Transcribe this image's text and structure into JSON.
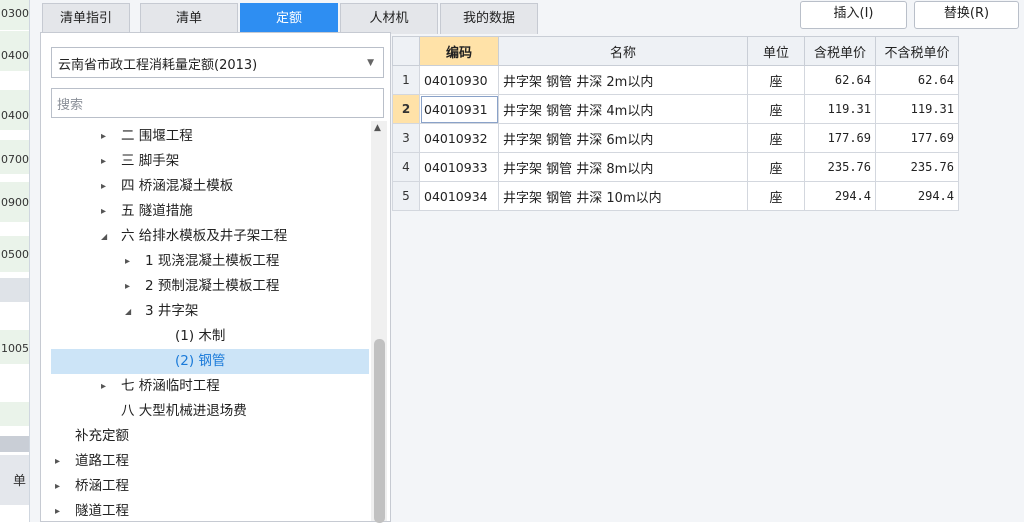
{
  "left_strip": {
    "cells": [
      "0300",
      "0400",
      "0400",
      "0700",
      "0900",
      "0500",
      "1005"
    ],
    "bottom_label": "单"
  },
  "tabs": [
    {
      "label": "清单指引",
      "active": false
    },
    {
      "label": "清单",
      "active": false
    },
    {
      "label": "定额",
      "active": true
    },
    {
      "label": "人材机",
      "active": false
    },
    {
      "label": "我的数据",
      "active": false
    }
  ],
  "toolbar": {
    "insert_label": "插入(I)",
    "replace_label": "替换(R)"
  },
  "library": {
    "selected": "云南省市政工程消耗量定额(2013)"
  },
  "search": {
    "placeholder": "搜索"
  },
  "tree": [
    {
      "label": "二 围堰工程",
      "expander": "▸"
    },
    {
      "label": "三 脚手架",
      "expander": "▸"
    },
    {
      "label": "四 桥涵混凝土模板",
      "expander": "▸"
    },
    {
      "label": "五 隧道措施",
      "expander": "▸"
    },
    {
      "label": "六 给排水模板及井子架工程",
      "expander": "◢"
    },
    {
      "label": "1 现浇混凝土模板工程",
      "expander": "▸"
    },
    {
      "label": "2 预制混凝土模板工程",
      "expander": "▸"
    },
    {
      "label": "3 井字架",
      "expander": "◢"
    },
    {
      "label": "(1) 木制",
      "expander": ""
    },
    {
      "label": "(2) 钢管",
      "expander": ""
    },
    {
      "label": "七 桥涵临时工程",
      "expander": "▸"
    },
    {
      "label": "八 大型机械进退场费",
      "expander": ""
    },
    {
      "label": "补充定额",
      "expander": ""
    },
    {
      "label": "道路工程",
      "expander": "▸"
    },
    {
      "label": "桥涵工程",
      "expander": "▸"
    },
    {
      "label": "隧道工程",
      "expander": "▸"
    }
  ],
  "grid": {
    "columns": [
      "编码",
      "名称",
      "单位",
      "含税单价",
      "不含税单价"
    ],
    "rows": [
      {
        "no": "1",
        "code": "04010930",
        "name": "井字架 钢管 井深 2m以内",
        "unit": "座",
        "tax_price": "62.64",
        "notax_price": "62.64"
      },
      {
        "no": "2",
        "code": "04010931",
        "name": "井字架 钢管 井深 4m以内",
        "unit": "座",
        "tax_price": "119.31",
        "notax_price": "119.31"
      },
      {
        "no": "3",
        "code": "04010932",
        "name": "井字架 钢管 井深 6m以内",
        "unit": "座",
        "tax_price": "177.69",
        "notax_price": "177.69"
      },
      {
        "no": "4",
        "code": "04010933",
        "name": "井字架 钢管 井深 8m以内",
        "unit": "座",
        "tax_price": "235.76",
        "notax_price": "235.76"
      },
      {
        "no": "5",
        "code": "04010934",
        "name": "井字架 钢管 井深 10m以内",
        "unit": "座",
        "tax_price": "294.4",
        "notax_price": "294.4"
      }
    ]
  },
  "colors": {
    "accent": "#2e8ef2",
    "selection": "#cce4f7",
    "header_highlight": "#ffe2a8"
  }
}
